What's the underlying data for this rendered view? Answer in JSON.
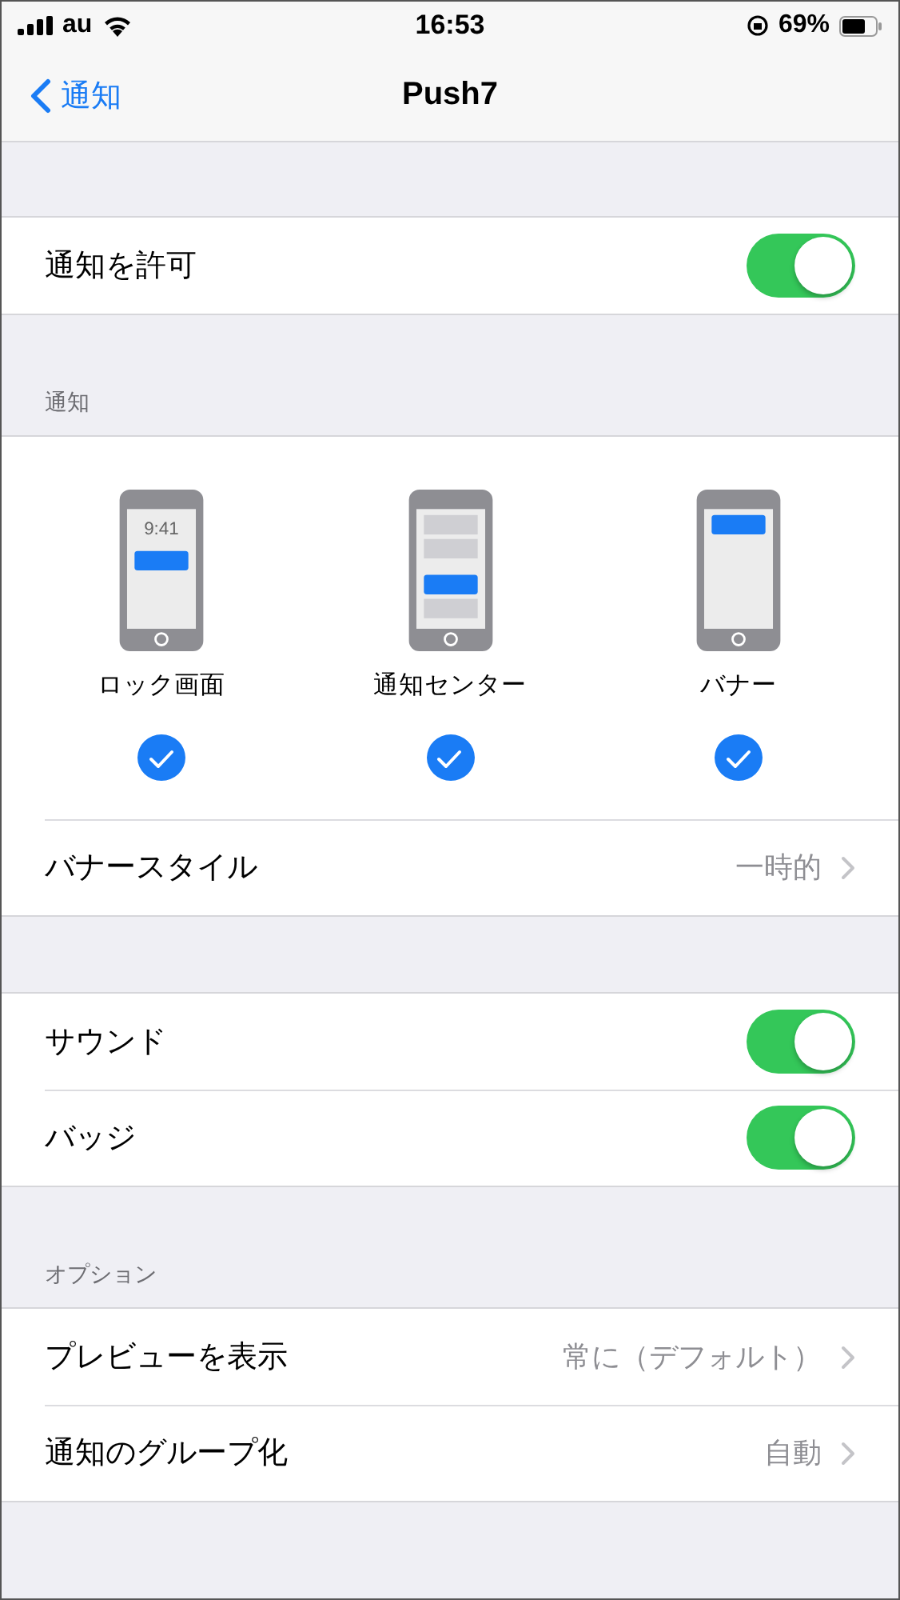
{
  "status_bar": {
    "carrier": "au",
    "time": "16:53",
    "battery_percent": "69%"
  },
  "nav": {
    "back": "通知",
    "title": "Push7"
  },
  "allow": {
    "label": "通知を許可",
    "on": true
  },
  "alerts_header": "通知",
  "alert_styles": [
    {
      "kind": "lock",
      "label": "ロック画面",
      "screen_time": "9:41",
      "checked": true
    },
    {
      "kind": "center",
      "label": "通知センター",
      "checked": true
    },
    {
      "kind": "banner",
      "label": "バナー",
      "checked": true
    }
  ],
  "banner_style": {
    "label": "バナースタイル",
    "value": "一時的"
  },
  "toggles": [
    {
      "label": "サウンド",
      "on": true
    },
    {
      "label": "バッジ",
      "on": true
    }
  ],
  "options_header": "オプション",
  "options": [
    {
      "label": "プレビューを表示",
      "value": "常に（デフォルト）"
    },
    {
      "label": "通知のグループ化",
      "value": "自動"
    }
  ]
}
